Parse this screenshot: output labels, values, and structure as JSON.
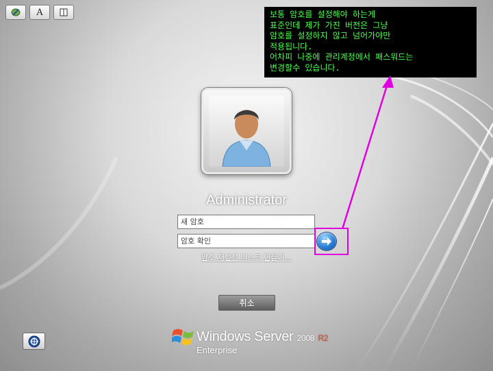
{
  "toolbar": {
    "buttons": [
      {
        "icon": "pen-icon"
      },
      {
        "icon": "font-icon",
        "label": "A"
      },
      {
        "icon": "panel-icon"
      }
    ]
  },
  "annotation": {
    "text": "보통 암호를 설정해야 하는게\n표준인데 제가 가진 버전은 그냥\n암호를 설정하지 않고 넘어가야만\n적용됩니다.\n어차피 나중에 관리계정에서 패스워드는\n변경할수 있습니다.",
    "text_color": "#4cff4c",
    "arrow_color": "#e000e0"
  },
  "user": {
    "name": "Administrator"
  },
  "password": {
    "new_placeholder": "새 암호",
    "confirm_placeholder": "암호 확인"
  },
  "submit": {
    "icon": "arrow-right-icon"
  },
  "reset_link": "암호 재설정 디스크 만들기...",
  "cancel_label": "취소",
  "ease_of_access": {
    "icon": "ease-of-access-icon"
  },
  "brand": {
    "name": "Windows Server",
    "version": "2008",
    "release": "R2",
    "edition": "Enterprise"
  }
}
